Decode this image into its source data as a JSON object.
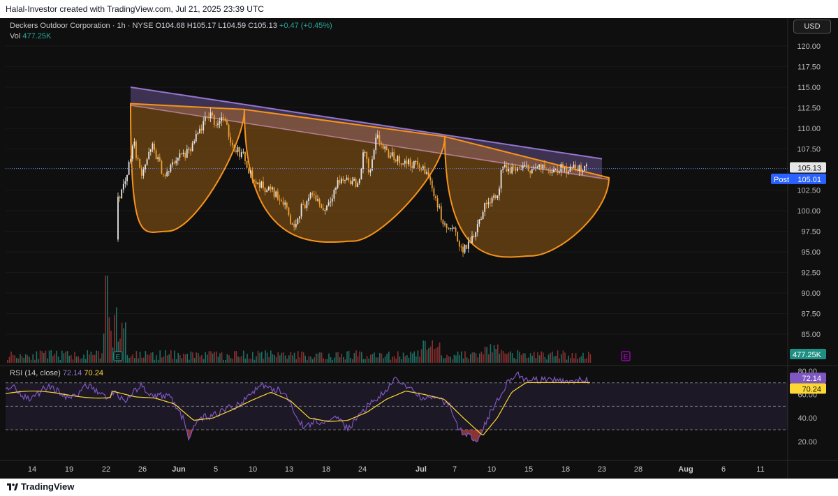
{
  "header": {
    "attribution": "Halal-Investor created with TradingView.com, Jul 21, 2025 23:39 UTC"
  },
  "legend": {
    "symbol": "Deckers Outdoor Corporation · 1h · NYSE",
    "open": "O104.68",
    "high": "H105.17",
    "low": "L104.59",
    "close": "C105.13",
    "change": "+0.47 (+0.45%)",
    "vol_label": "Vol",
    "vol_value": "477.25K"
  },
  "currency": "USD",
  "price_badges": {
    "last": "105.13",
    "post_label": "Post",
    "post": "105.01",
    "volume": "477.25K"
  },
  "rsi_legend": {
    "label": "RSI (14, close)",
    "rsi": "72.14",
    "ma": "70.24"
  },
  "rsi_badges": {
    "rsi": "72.14",
    "ma": "70.24"
  },
  "footer": {
    "brand": "TradingView"
  },
  "earnings_marker": "E",
  "colors": {
    "up": "#26a69a",
    "down": "#ef5350",
    "pattern": "#f7931a",
    "channel": "#9575cd",
    "rsi": "#7e57c2",
    "rsi_ma": "#fdd835"
  },
  "chart_data": {
    "type": "candlestick",
    "price_axis": {
      "ticks": [
        "120.00",
        "117.50",
        "115.00",
        "112.50",
        "110.00",
        "107.50",
        "105.00",
        "102.50",
        "100.00",
        "97.50",
        "95.00",
        "92.50",
        "90.00",
        "87.50",
        "85.00"
      ],
      "range": [
        84.0,
        121.5
      ]
    },
    "rsi_axis": {
      "ticks": [
        "80.00",
        "60.00",
        "40.00",
        "20.00"
      ],
      "levels": [
        70,
        50,
        30
      ],
      "range": [
        10,
        85
      ]
    },
    "time_axis": {
      "labels": [
        "14",
        "19",
        "22",
        "26",
        "Jun",
        "5",
        "10",
        "13",
        "18",
        "24",
        "Jul",
        "7",
        "10",
        "15",
        "18",
        "23",
        "28",
        "Aug",
        "6",
        "11"
      ],
      "bold": [
        "Jun",
        "Jul",
        "Aug"
      ]
    },
    "price_keypoints": [
      {
        "t": 0.0,
        "p": 96.5
      },
      {
        "t": 0.01,
        "p": 100.8
      },
      {
        "t": 0.03,
        "p": 104.0
      },
      {
        "t": 0.045,
        "p": 108.5
      },
      {
        "t": 0.06,
        "p": 104.5
      },
      {
        "t": 0.085,
        "p": 107.8
      },
      {
        "t": 0.11,
        "p": 104.0
      },
      {
        "t": 0.135,
        "p": 106.5
      },
      {
        "t": 0.16,
        "p": 107.0
      },
      {
        "t": 0.185,
        "p": 110.0
      },
      {
        "t": 0.205,
        "p": 112.0
      },
      {
        "t": 0.215,
        "p": 110.5
      },
      {
        "t": 0.23,
        "p": 111.5
      },
      {
        "t": 0.25,
        "p": 108.0
      },
      {
        "t": 0.275,
        "p": 106.5
      },
      {
        "t": 0.295,
        "p": 103.5
      },
      {
        "t": 0.33,
        "p": 102.5
      },
      {
        "t": 0.36,
        "p": 101.0
      },
      {
        "t": 0.375,
        "p": 98.0
      },
      {
        "t": 0.395,
        "p": 100.5
      },
      {
        "t": 0.42,
        "p": 102.0
      },
      {
        "t": 0.44,
        "p": 100.0
      },
      {
        "t": 0.47,
        "p": 103.5
      },
      {
        "t": 0.49,
        "p": 104.0
      },
      {
        "t": 0.51,
        "p": 103.0
      },
      {
        "t": 0.525,
        "p": 107.5
      },
      {
        "t": 0.535,
        "p": 104.0
      },
      {
        "t": 0.55,
        "p": 109.0
      },
      {
        "t": 0.57,
        "p": 107.0
      },
      {
        "t": 0.6,
        "p": 106.0
      },
      {
        "t": 0.635,
        "p": 105.5
      },
      {
        "t": 0.655,
        "p": 104.5
      },
      {
        "t": 0.67,
        "p": 102.0
      },
      {
        "t": 0.69,
        "p": 98.0
      },
      {
        "t": 0.71,
        "p": 97.5
      },
      {
        "t": 0.73,
        "p": 95.0
      },
      {
        "t": 0.75,
        "p": 97.0
      },
      {
        "t": 0.77,
        "p": 100.0
      },
      {
        "t": 0.79,
        "p": 102.0
      },
      {
        "t": 0.8,
        "p": 101.5
      },
      {
        "t": 0.81,
        "p": 105.0
      },
      {
        "t": 0.825,
        "p": 105.0
      },
      {
        "t": 0.84,
        "p": 105.13
      }
    ],
    "rsi_keypoints": [
      {
        "t": 0.0,
        "r": 63
      },
      {
        "t": 0.03,
        "r": 55
      },
      {
        "t": 0.06,
        "r": 68
      },
      {
        "t": 0.09,
        "r": 58
      },
      {
        "t": 0.12,
        "r": 60
      },
      {
        "t": 0.15,
        "r": 38
      },
      {
        "t": 0.16,
        "r": 20
      },
      {
        "t": 0.18,
        "r": 40
      },
      {
        "t": 0.21,
        "r": 42
      },
      {
        "t": 0.24,
        "r": 48
      },
      {
        "t": 0.27,
        "r": 52
      },
      {
        "t": 0.29,
        "r": 62
      },
      {
        "t": 0.31,
        "r": 68
      },
      {
        "t": 0.33,
        "r": 65
      },
      {
        "t": 0.36,
        "r": 62
      },
      {
        "t": 0.38,
        "r": 45
      },
      {
        "t": 0.4,
        "r": 30
      },
      {
        "t": 0.42,
        "r": 38
      },
      {
        "t": 0.45,
        "r": 35
      },
      {
        "t": 0.47,
        "r": 42
      },
      {
        "t": 0.49,
        "r": 30
      },
      {
        "t": 0.51,
        "r": 40
      },
      {
        "t": 0.53,
        "r": 50
      },
      {
        "t": 0.55,
        "r": 57
      },
      {
        "t": 0.57,
        "r": 62
      },
      {
        "t": 0.59,
        "r": 76
      },
      {
        "t": 0.61,
        "r": 66
      },
      {
        "t": 0.63,
        "r": 62
      },
      {
        "t": 0.65,
        "r": 55
      },
      {
        "t": 0.67,
        "r": 58
      },
      {
        "t": 0.7,
        "r": 52
      },
      {
        "t": 0.72,
        "r": 30
      },
      {
        "t": 0.74,
        "r": 25
      },
      {
        "t": 0.76,
        "r": 22
      },
      {
        "t": 0.78,
        "r": 40
      },
      {
        "t": 0.8,
        "r": 55
      },
      {
        "t": 0.82,
        "r": 70
      },
      {
        "t": 0.84,
        "r": 78
      },
      {
        "t": 0.86,
        "r": 72
      }
    ],
    "rsi_ma_keypoints": [
      {
        "t": 0.0,
        "r": 63
      },
      {
        "t": 0.05,
        "r": 58
      },
      {
        "t": 0.09,
        "r": 57
      },
      {
        "t": 0.13,
        "r": 52
      },
      {
        "t": 0.17,
        "r": 38
      },
      {
        "t": 0.21,
        "r": 40
      },
      {
        "t": 0.25,
        "r": 47
      },
      {
        "t": 0.29,
        "r": 55
      },
      {
        "t": 0.33,
        "r": 62
      },
      {
        "t": 0.37,
        "r": 55
      },
      {
        "t": 0.41,
        "r": 40
      },
      {
        "t": 0.45,
        "r": 37
      },
      {
        "t": 0.49,
        "r": 38
      },
      {
        "t": 0.53,
        "r": 45
      },
      {
        "t": 0.57,
        "r": 56
      },
      {
        "t": 0.61,
        "r": 63
      },
      {
        "t": 0.65,
        "r": 60
      },
      {
        "t": 0.69,
        "r": 56
      },
      {
        "t": 0.73,
        "r": 40
      },
      {
        "t": 0.77,
        "r": 25
      },
      {
        "t": 0.8,
        "r": 40
      },
      {
        "t": 0.83,
        "r": 62
      },
      {
        "t": 0.86,
        "r": 70.24
      }
    ],
    "pattern": {
      "cups_price": [
        [
          113.0,
          97.5,
          112.3
        ],
        [
          112.3,
          96.3,
          109.0
        ],
        [
          109.0,
          94.5,
          104.0
        ]
      ],
      "channel_upper": [
        115.0,
        106.3
      ],
      "channel_lower": [
        112.8,
        103.8
      ]
    },
    "last_price": 105.13,
    "post_price": 105.01,
    "volume": "477.25K"
  }
}
